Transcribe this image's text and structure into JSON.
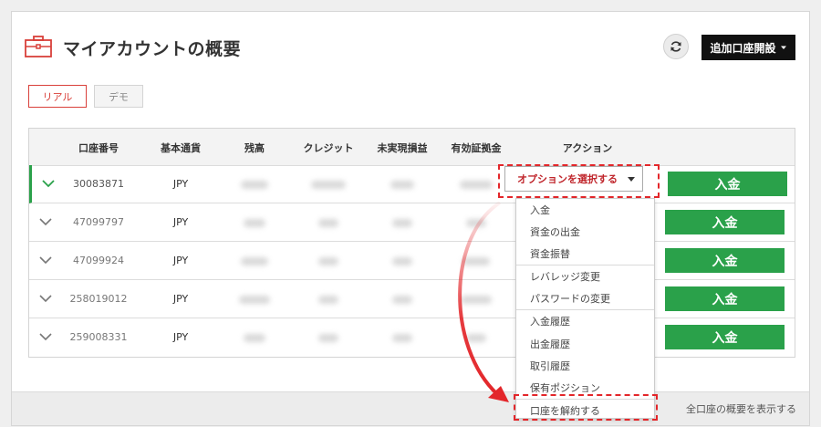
{
  "header": {
    "title": "マイアカウントの概要",
    "add_account_label": "追加口座開設",
    "title_icon": "briefcase-icon",
    "refresh_icon": "refresh-icon"
  },
  "tabs": [
    {
      "label": "リアル",
      "active": true
    },
    {
      "label": "デモ",
      "active": false
    }
  ],
  "table": {
    "columns": [
      "口座番号",
      "基本通貨",
      "残高",
      "クレジット",
      "未実現損益",
      "有効証拠金",
      "アクション"
    ],
    "rows": [
      {
        "account": "30083871",
        "currency": "JPY",
        "selected": true
      },
      {
        "account": "47099797",
        "currency": "JPY",
        "selected": false
      },
      {
        "account": "47099924",
        "currency": "JPY",
        "selected": false
      },
      {
        "account": "258019012",
        "currency": "JPY",
        "selected": false
      },
      {
        "account": "259008331",
        "currency": "JPY",
        "selected": false
      }
    ],
    "deposit_label": "入金"
  },
  "action_select": {
    "selected_label": "オプションを選択する",
    "options": [
      "入金",
      "資金の出金",
      "資金振替",
      "レバレッジ変更",
      "パスワードの変更",
      "入金履歴",
      "出金履歴",
      "取引履歴",
      "保有ポジション",
      "口座を解約する"
    ]
  },
  "footer": {
    "link": "全口座の概要を表示する"
  },
  "colors": {
    "accent_red": "#d9403a",
    "deposit_green": "#2aa14a",
    "highlight_red": "#e3262a",
    "dark_button": "#111111"
  }
}
